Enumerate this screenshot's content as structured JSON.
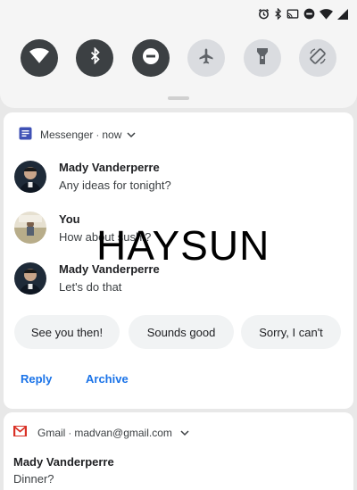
{
  "quick_settings": {
    "status_icons": [
      "alarm-icon",
      "bluetooth-icon",
      "cast-icon",
      "dnd-icon",
      "wifi-icon",
      "signal-icon"
    ],
    "tiles": [
      {
        "name": "wifi",
        "state": "on"
      },
      {
        "name": "bluetooth",
        "state": "on"
      },
      {
        "name": "do-not-disturb",
        "state": "on"
      },
      {
        "name": "airplane-mode",
        "state": "off"
      },
      {
        "name": "flashlight",
        "state": "off"
      },
      {
        "name": "auto-rotate",
        "state": "off"
      }
    ]
  },
  "messenger_notification": {
    "app_name": "Messenger",
    "separator": "·",
    "time": "now",
    "messages": [
      {
        "sender": "Mady Vanderperre",
        "text": "Any ideas for tonight?"
      },
      {
        "sender": "You",
        "text": "How about sushi?"
      },
      {
        "sender": "Mady Vanderperre",
        "text": "Let's do that"
      }
    ],
    "smart_replies": [
      "See you then!",
      "Sounds good",
      "Sorry, I can't"
    ],
    "actions": [
      "Reply",
      "Archive"
    ]
  },
  "watermark": "HAYSUN",
  "gmail_notification": {
    "app_name": "Gmail",
    "separator": "·",
    "account": "madvan@gmail.com",
    "sender": "Mady Vanderperre",
    "subject": "Dinner?"
  },
  "colors": {
    "accent": "#1a73e8",
    "tile_on": "#3c4043",
    "tile_off": "#dadce0",
    "messenger_icon": "#3f51b5",
    "gmail_red": "#d93025"
  }
}
